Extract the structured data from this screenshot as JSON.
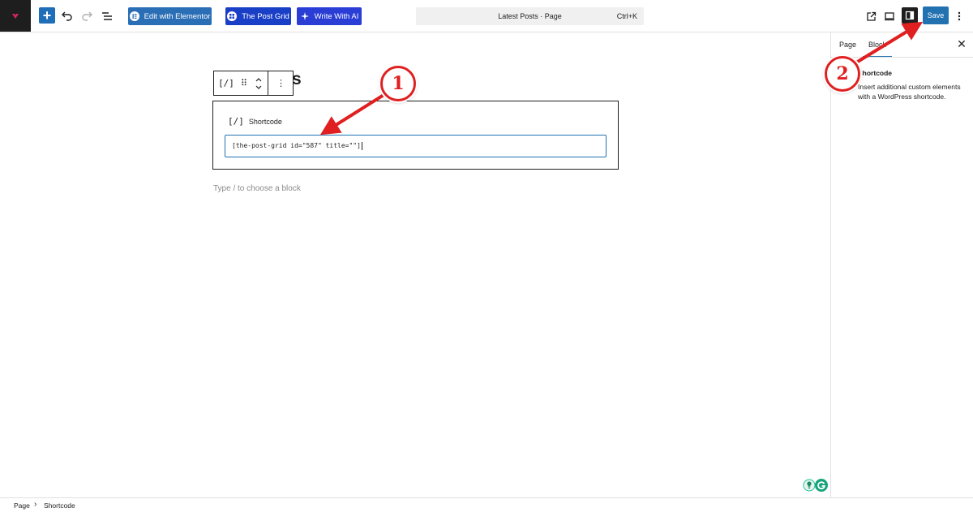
{
  "toolbar": {
    "add_label": "+",
    "edit_with_elementor": "Edit with Elementor",
    "the_post_grid": "The Post Grid",
    "write_with_ai": "Write With AI",
    "command_title": "Latest Posts · Page",
    "command_shortcut": "Ctrl+K",
    "save_label": "Save"
  },
  "canvas": {
    "title_visible": "ts",
    "block_toolbar": {
      "shortcode_icon": "[/]",
      "drag_icon": "⠿",
      "more_icon": "⋮"
    },
    "shortcode_block": {
      "label": "Shortcode",
      "icon": "[/]",
      "value": "[the-post-grid id=\"587\" title=\"\"]"
    },
    "appender_placeholder": "Type / to choose a block"
  },
  "sidebar": {
    "tabs": [
      {
        "label": "Page",
        "active": false
      },
      {
        "label": "Block",
        "active": true
      }
    ],
    "close_icon": "✕",
    "block_title": "Shortcode",
    "block_description": "Insert additional custom elements with a WordPress shortcode."
  },
  "footer": {
    "breadcrumb": [
      "Page",
      "Shortcode"
    ],
    "separator": "›"
  },
  "annotations": {
    "step1": "1",
    "step2": "2",
    "color": "#e02020"
  },
  "colors": {
    "accent": "#2271b1",
    "elementor": "#2a6eb6",
    "post_grid": "#1a3fc7",
    "write_ai": "#2a3ed6",
    "dark": "#1e1e1e"
  }
}
